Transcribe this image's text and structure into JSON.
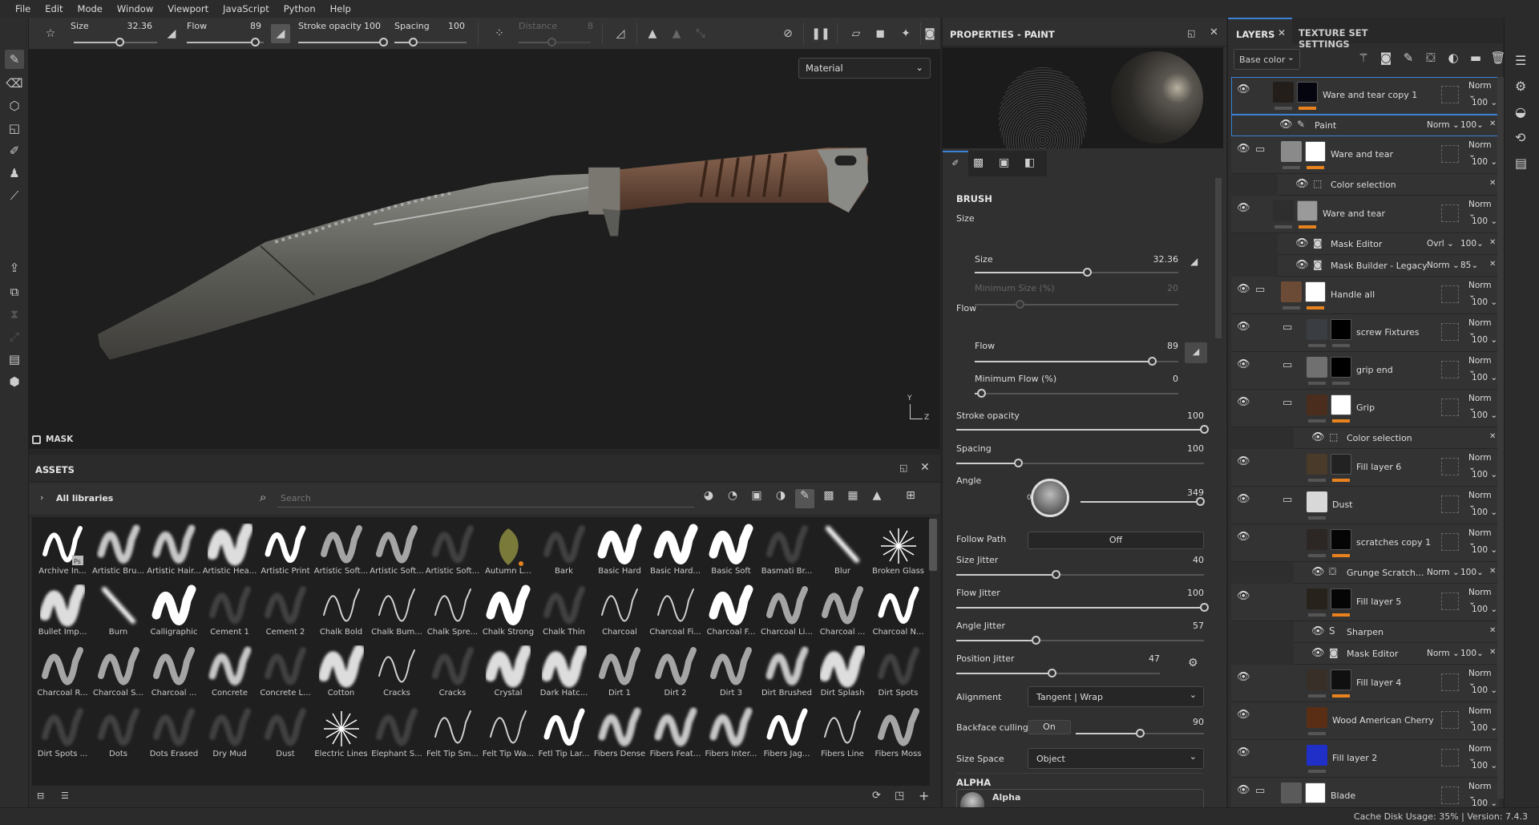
{
  "menu": [
    "File",
    "Edit",
    "Mode",
    "Window",
    "Viewport",
    "JavaScript",
    "Python",
    "Help"
  ],
  "toolbar": {
    "size_label": "Size",
    "size_value": "32.36",
    "size_fill": 0.55,
    "flow_label": "Flow",
    "flow_value": "89",
    "flow_fill": 0.89,
    "stroke_label": "Stroke opacity",
    "stroke_value": "100",
    "stroke_fill": 1.0,
    "spacing_label": "Spacing",
    "spacing_value": "100",
    "spacing_fill": 0.25,
    "distance_label": "Distance",
    "distance_value": "8",
    "distance_fill": 0.45
  },
  "viewport": {
    "material_select": "Material",
    "mask_label": "MASK",
    "axis_y": "Y",
    "axis_z": "Z"
  },
  "assets": {
    "title": "ASSETS",
    "library": "All libraries",
    "search_placeholder": "Search",
    "brushes": [
      {
        "name": "Archive In...",
        "thumb": "hard-ps"
      },
      {
        "name": "Artistic Bru...",
        "thumb": "soft"
      },
      {
        "name": "Artistic Hair...",
        "thumb": "soft"
      },
      {
        "name": "Artistic Hea...",
        "thumb": "blob"
      },
      {
        "name": "Artistic Print",
        "thumb": "hard"
      },
      {
        "name": "Artistic Soft...",
        "thumb": "noise"
      },
      {
        "name": "Artistic Soft...",
        "thumb": "noise"
      },
      {
        "name": "Artistic Soft...",
        "thumb": "faint"
      },
      {
        "name": "Autumn L...",
        "thumb": "leaf"
      },
      {
        "name": "Bark",
        "thumb": "faint"
      },
      {
        "name": "Basic Hard",
        "thumb": "thick"
      },
      {
        "name": "Basic Hard...",
        "thumb": "thick"
      },
      {
        "name": "Basic Soft",
        "thumb": "thick"
      },
      {
        "name": "Basmati Br...",
        "thumb": "faint"
      },
      {
        "name": "Blur",
        "thumb": "streak"
      },
      {
        "name": "Broken Glass",
        "thumb": "star"
      },
      {
        "name": "Bullet Imp...",
        "thumb": "blob"
      },
      {
        "name": "Burn",
        "thumb": "streak"
      },
      {
        "name": "Calligraphic",
        "thumb": "thick"
      },
      {
        "name": "Cement 1",
        "thumb": "faint"
      },
      {
        "name": "Cement 2",
        "thumb": "faint"
      },
      {
        "name": "Chalk Bold",
        "thumb": "thin"
      },
      {
        "name": "Chalk Bum...",
        "thumb": "thin"
      },
      {
        "name": "Chalk Spre...",
        "thumb": "thin"
      },
      {
        "name": "Chalk Strong",
        "thumb": "thick"
      },
      {
        "name": "Chalk Thin",
        "thumb": "faint"
      },
      {
        "name": "Charcoal",
        "thumb": "thin"
      },
      {
        "name": "Charcoal Fi...",
        "thumb": "thin"
      },
      {
        "name": "Charcoal F...",
        "thumb": "thick"
      },
      {
        "name": "Charcoal Li...",
        "thumb": "noise"
      },
      {
        "name": "Charcoal ...",
        "thumb": "noise"
      },
      {
        "name": "Charcoal N...",
        "thumb": "hard"
      },
      {
        "name": "Charcoal R...",
        "thumb": "noise"
      },
      {
        "name": "Charcoal S...",
        "thumb": "noise"
      },
      {
        "name": "Charcoal ...",
        "thumb": "noise"
      },
      {
        "name": "Concrete",
        "thumb": "soft"
      },
      {
        "name": "Concrete L...",
        "thumb": "faint"
      },
      {
        "name": "Cotton",
        "thumb": "blob"
      },
      {
        "name": "Cracks",
        "thumb": "thin"
      },
      {
        "name": "Cracks",
        "thumb": "faint"
      },
      {
        "name": "Crystal",
        "thumb": "blob"
      },
      {
        "name": "Dark Hatc...",
        "thumb": "blob"
      },
      {
        "name": "Dirt 1",
        "thumb": "noise"
      },
      {
        "name": "Dirt 2",
        "thumb": "noise"
      },
      {
        "name": "Dirt 3",
        "thumb": "noise"
      },
      {
        "name": "Dirt Brushed",
        "thumb": "soft"
      },
      {
        "name": "Dirt Splash",
        "thumb": "blob"
      },
      {
        "name": "Dirt Spots",
        "thumb": "faint"
      },
      {
        "name": "Dirt Spots ...",
        "thumb": "faint"
      },
      {
        "name": "Dots",
        "thumb": "faint"
      },
      {
        "name": "Dots Erased",
        "thumb": "faint"
      },
      {
        "name": "Dry Mud",
        "thumb": "faint"
      },
      {
        "name": "Dust",
        "thumb": "faint"
      },
      {
        "name": "Electric Lines",
        "thumb": "star"
      },
      {
        "name": "Elephant S...",
        "thumb": "faint"
      },
      {
        "name": "Felt Tip Sm...",
        "thumb": "thin"
      },
      {
        "name": "Felt Tip Wa...",
        "thumb": "thin"
      },
      {
        "name": "Fetl Tip Lar...",
        "thumb": "hard"
      },
      {
        "name": "Fibers Dense",
        "thumb": "soft"
      },
      {
        "name": "Fibers Feat...",
        "thumb": "soft"
      },
      {
        "name": "Fibers Inter...",
        "thumb": "soft"
      },
      {
        "name": "Fibers Jag...",
        "thumb": "hard"
      },
      {
        "name": "Fibers Line",
        "thumb": "thin"
      },
      {
        "name": "Fibers Moss",
        "thumb": "noise"
      }
    ]
  },
  "properties": {
    "title": "PROPERTIES - PAINT",
    "brush_section": "BRUSH",
    "size_group": "Size",
    "flow_group": "Flow",
    "sliders": [
      {
        "label": "Size",
        "value": "32.36",
        "fill": 0.55
      },
      {
        "label": "Minimum Size (%)",
        "value": "20",
        "fill": 0.22
      },
      {
        "label": "Flow",
        "value": "89",
        "fill": 0.87
      },
      {
        "label": "Minimum Flow (%)",
        "value": "0",
        "fill": 0.03
      },
      {
        "label": "Stroke opacity",
        "value": "100",
        "fill": 1.0
      },
      {
        "label": "Spacing",
        "value": "100",
        "fill": 0.25
      },
      {
        "label": "Angle",
        "value": "349",
        "fill": 0.97
      },
      {
        "label": "Size Jitter",
        "value": "40",
        "fill": 0.4
      },
      {
        "label": "Flow Jitter",
        "value": "100",
        "fill": 1.0
      },
      {
        "label": "Angle Jitter",
        "value": "57",
        "fill": 0.32
      },
      {
        "label": "Position Jitter",
        "value": "47",
        "fill": 0.47
      },
      {
        "label": "Backface culling",
        "value": "90",
        "fill": 0.5
      }
    ],
    "angle_zero": "0",
    "follow_path_label": "Follow Path",
    "follow_path_value": "Off",
    "alignment_label": "Alignment",
    "alignment_value": "Tangent | Wrap",
    "backface_toggle": "On",
    "size_space_label": "Size Space",
    "size_space_value": "Object",
    "alpha_section": "ALPHA",
    "alpha_name": "Alpha"
  },
  "layers": {
    "tab_layers": "LAYERS",
    "tab_texture": "TEXTURE SET SETTINGS",
    "channel": "Base color",
    "accent": "#e8821e",
    "selection": "#3b82d6",
    "rows": [
      {
        "kind": "main",
        "name": "Ware and tear copy 1",
        "blend": "Norm",
        "opacity": "100",
        "indent": 0,
        "folder": false,
        "thumb": "#231e1a",
        "mask": "#050510",
        "bar": true,
        "sel": true
      },
      {
        "kind": "sub",
        "name": "Paint",
        "icon": "brush",
        "blend": "Norm",
        "opacity": "100",
        "indent": 0,
        "sel": true
      },
      {
        "kind": "main",
        "name": "Ware and tear",
        "blend": "Norm",
        "opacity": "100",
        "indent": 0,
        "folder": true,
        "thumb": "#8a8a8a",
        "mask": "#ffffff",
        "bar": true
      },
      {
        "kind": "sub",
        "name": "Color selection",
        "icon": "selection",
        "blend": "",
        "opacity": "",
        "indent": 1
      },
      {
        "kind": "main",
        "name": "Ware and tear",
        "blend": "Norm",
        "opacity": "100",
        "indent": 0,
        "folder": false,
        "thumb": "#2e2e2e",
        "mask": "#9a9a9a",
        "bar": true
      },
      {
        "kind": "sub",
        "name": "Mask Editor",
        "icon": "mask",
        "blend": "Ovrl",
        "opacity": "100",
        "indent": 1
      },
      {
        "kind": "sub",
        "name": "Mask Builder - Legacy",
        "icon": "mask",
        "blend": "Norm",
        "opacity": "85",
        "indent": 1
      },
      {
        "kind": "main",
        "name": "Handle all",
        "blend": "Norm",
        "opacity": "100",
        "indent": 0,
        "folder": true,
        "thumb": "#6b4a36",
        "mask": "#ffffff",
        "bar": true
      },
      {
        "kind": "main",
        "name": "screw Fixtures",
        "blend": "Norm",
        "opacity": "100",
        "indent": 1,
        "folder": true,
        "thumb": "#3a3d42",
        "mask": "#000000",
        "bar": false
      },
      {
        "kind": "main",
        "name": "grip end",
        "blend": "Norm",
        "opacity": "100",
        "indent": 1,
        "folder": true,
        "thumb": "#707070",
        "mask": "#000000",
        "bar": false
      },
      {
        "kind": "main",
        "name": "Grip",
        "blend": "Norm",
        "opacity": "100",
        "indent": 1,
        "folder": true,
        "thumb": "#4a2d1c",
        "mask": "#ffffff",
        "bar": true
      },
      {
        "kind": "sub",
        "name": "Color selection",
        "icon": "selection",
        "blend": "",
        "opacity": "",
        "indent": 2
      },
      {
        "kind": "main",
        "name": "Fill layer 6",
        "blend": "Norm",
        "opacity": "100",
        "indent": 2,
        "folder": false,
        "thumb": "#4a3a2a",
        "mask": "#222222",
        "bar": true
      },
      {
        "kind": "main",
        "name": "Dust",
        "blend": "Norm",
        "opacity": "100",
        "indent": 2,
        "folder": true,
        "thumb": "#d8d8d8",
        "mask": "",
        "bar": false
      },
      {
        "kind": "main",
        "name": "scratches copy 1",
        "blend": "Norm",
        "opacity": "100",
        "indent": 2,
        "folder": false,
        "thumb": "#2c2624",
        "mask": "#050505",
        "bar": true
      },
      {
        "kind": "sub",
        "name": "Grunge Scratch...",
        "icon": "fill",
        "blend": "Norm",
        "opacity": "100",
        "indent": 2
      },
      {
        "kind": "main",
        "name": "Fill layer 5",
        "blend": "Norm",
        "opacity": "100",
        "indent": 2,
        "folder": false,
        "thumb": "#28221c",
        "mask": "#050505",
        "bar": true
      },
      {
        "kind": "sub",
        "name": "Sharpen",
        "icon": "substance",
        "blend": "",
        "opacity": "",
        "indent": 2
      },
      {
        "kind": "sub",
        "name": "Mask Editor",
        "icon": "mask",
        "blend": "Norm",
        "opacity": "100",
        "indent": 2
      },
      {
        "kind": "main",
        "name": "Fill layer 4",
        "blend": "Norm",
        "opacity": "100",
        "indent": 2,
        "folder": false,
        "thumb": "#383028",
        "mask": "#101010",
        "bar": true
      },
      {
        "kind": "main",
        "name": "Wood American Cherry",
        "blend": "Norm",
        "opacity": "100",
        "indent": 2,
        "folder": false,
        "thumb": "#5a2e14",
        "mask": "",
        "bar": false
      },
      {
        "kind": "main",
        "name": "Fill layer 2",
        "blend": "Norm",
        "opacity": "100",
        "indent": 2,
        "folder": false,
        "thumb": "#1f2fc8",
        "mask": "",
        "bar": false
      },
      {
        "kind": "main",
        "name": "Blade",
        "blend": "Norm",
        "opacity": "100",
        "indent": 0,
        "folder": true,
        "thumb": "#5a5a5a",
        "mask": "#ffffff",
        "bar": true
      }
    ]
  },
  "status": {
    "cache_label": "Cache Disk Usage:",
    "cache_value": "35%",
    "version": "| Version: 7.4.3"
  }
}
